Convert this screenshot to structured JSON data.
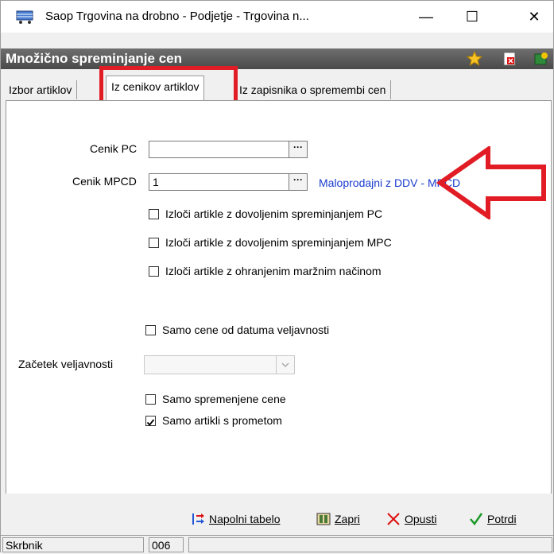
{
  "window": {
    "title": "Saop Trgovina na drobno - Podjetje - Trgovina n...",
    "controls": {
      "minimize": "—",
      "maximize": "☐",
      "close": "✕"
    }
  },
  "header": {
    "title": "Množično spreminjanje cen"
  },
  "tabs": [
    {
      "label": "Izbor artiklov",
      "active": false
    },
    {
      "label": "Iz cenikov artiklov",
      "active": true
    },
    {
      "label": "Iz zapisnika o spremembi cen",
      "active": false
    }
  ],
  "form": {
    "cenik_pc": {
      "label": "Cenik PC",
      "value": "",
      "button": "···"
    },
    "cenik_mpcd": {
      "label": "Cenik MPCD",
      "value": "1",
      "button": "···",
      "description": "Maloprodajni z DDV - MPCD"
    },
    "checkboxes": [
      {
        "label": "Izloči artikle z dovoljenim spreminjanjem PC",
        "checked": false
      },
      {
        "label": "Izloči artikle z dovoljenim spreminjanjem MPC",
        "checked": false
      },
      {
        "label": "Izloči artikle z ohranjenim maržnim načinom",
        "checked": false
      }
    ],
    "samo_cene_od_datuma": {
      "label": "Samo cene od datuma veljavnosti",
      "checked": false
    },
    "zacetek_veljavnosti": {
      "label": "Začetek veljavnosti",
      "value": ""
    },
    "samo_spremenjene": {
      "label": "Samo spremenjene cene",
      "checked": false
    },
    "samo_artikli_promet": {
      "label": "Samo artikli s prometom",
      "checked": true
    }
  },
  "buttons": {
    "napolni": "Napolni tabelo",
    "zapri": "Zapri",
    "opusti": "Opusti",
    "potrdi": "Potrdi"
  },
  "status": {
    "user": "Skrbnik",
    "code": "006"
  },
  "colors": {
    "annotation": "#e11c24",
    "link": "#1a3ccf"
  }
}
